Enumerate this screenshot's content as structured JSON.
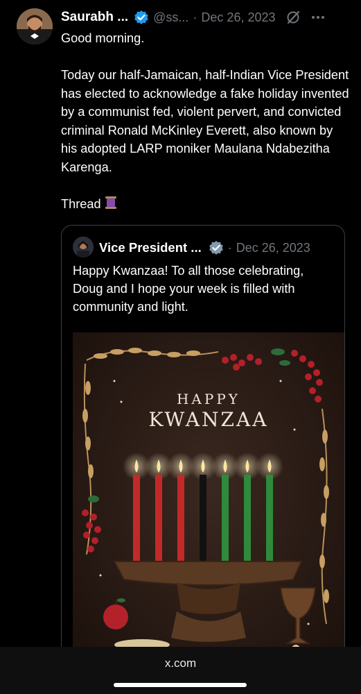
{
  "post": {
    "author_name": "Saurabh ...",
    "handle": "@ss...",
    "separator": "·",
    "date": "Dec 26, 2023",
    "avatar_icon": "profile-photo",
    "verified_icon": "verified-badge-icon",
    "paragraphs": [
      "Good morning.",
      "Today our half-Jamaican, half-Indian Vice President has elected to acknowledge a fake holiday invented by a communist fed, violent pervert, and convicted criminal Ronald McKinley Everett, also known by his adopted LARP moniker Maulana Ndabezitha Karenga.",
      "Thread"
    ],
    "thread_emoji": "spool-of-thread-icon"
  },
  "quote": {
    "author_name": "Vice President ...",
    "separator": "·",
    "date": "Dec 26, 2023",
    "text": "Happy Kwanzaa! To all those celebrating, Doug and I hope your week is filled with community and light.",
    "image": {
      "line1": "HAPPY",
      "line2": "KWANZAA",
      "candle_colors": [
        "#c22a2a",
        "#c22a2a",
        "#c22a2a",
        "#111111",
        "#2f8a3c",
        "#2f8a3c",
        "#2f8a3c"
      ]
    }
  },
  "browser": {
    "url": "x.com"
  },
  "colors": {
    "accent": "#1d9bf0",
    "muted": "#71767b",
    "background": "#000000"
  }
}
